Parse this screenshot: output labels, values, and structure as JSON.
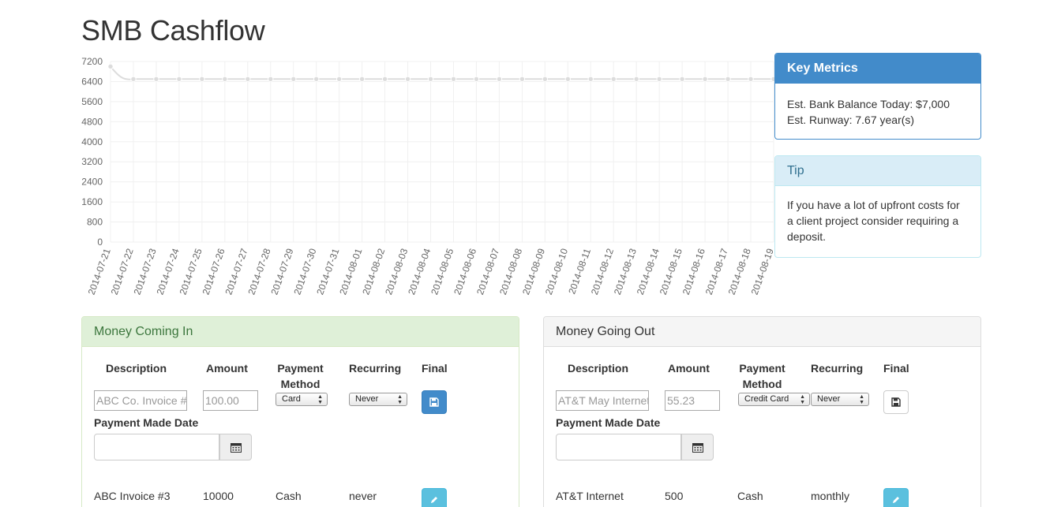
{
  "page": {
    "title": "SMB Cashflow"
  },
  "chart_data": {
    "type": "line",
    "categories": [
      "2014-07-21",
      "2014-07-22",
      "2014-07-23",
      "2014-07-24",
      "2014-07-25",
      "2014-07-26",
      "2014-07-27",
      "2014-07-28",
      "2014-07-29",
      "2014-07-30",
      "2014-07-31",
      "2014-08-01",
      "2014-08-02",
      "2014-08-03",
      "2014-08-04",
      "2014-08-05",
      "2014-08-06",
      "2014-08-07",
      "2014-08-08",
      "2014-08-09",
      "2014-08-10",
      "2014-08-11",
      "2014-08-12",
      "2014-08-13",
      "2014-08-14",
      "2014-08-15",
      "2014-08-16",
      "2014-08-17",
      "2014-08-18",
      "2014-08-19"
    ],
    "values": [
      7000,
      6500,
      6500,
      6500,
      6500,
      6500,
      6500,
      6500,
      6500,
      6500,
      6500,
      6500,
      6500,
      6500,
      6500,
      6500,
      6500,
      6500,
      6500,
      6500,
      6500,
      6500,
      6500,
      6500,
      6500,
      6500,
      6500,
      6500,
      6500,
      6500
    ],
    "yticks": [
      0,
      800,
      1600,
      2400,
      3200,
      4000,
      4800,
      5600,
      6400,
      7200
    ],
    "ylim": [
      0,
      7200
    ],
    "grid": true,
    "colors": {
      "line": "#dcdcdc",
      "point": "#dcdcdc",
      "grid": "#f0f0f0",
      "tick_text": "#666666"
    }
  },
  "metrics": {
    "heading": "Key Metrics",
    "balance": "Est. Bank Balance Today: $7,000",
    "runway": "Est. Runway: 7.67 year(s)"
  },
  "tip": {
    "heading": "Tip",
    "text": "If you have a lot of upfront costs for a client project consider requiring a deposit."
  },
  "money_in": {
    "heading": "Money Coming In",
    "columns": {
      "description": "Description",
      "amount": "Amount",
      "payment_method": "Payment Method",
      "recurring": "Recurring",
      "final": "Final"
    },
    "new_entry": {
      "description_placeholder": "ABC Co. Invoice #",
      "amount_placeholder": "100.00",
      "payment_method": "Card",
      "recurring": "Never"
    },
    "date_label": "Payment Made Date",
    "rows": [
      {
        "description": "ABC Invoice #3",
        "amount": "10000",
        "payment_method": "Cash",
        "recurring": "never"
      }
    ]
  },
  "money_out": {
    "heading": "Money Going Out",
    "columns": {
      "description": "Description",
      "amount": "Amount",
      "payment_method": "Payment Method",
      "recurring": "Recurring",
      "final": "Final"
    },
    "new_entry": {
      "description_placeholder": "AT&T May Internet",
      "amount_placeholder": "55.23",
      "payment_method": "Credit Card",
      "recurring": "Never"
    },
    "date_label": "Payment Made Date",
    "rows": [
      {
        "description": "AT&T Internet",
        "amount": "500",
        "payment_method": "Cash",
        "recurring": "monthly"
      }
    ]
  },
  "icons": {
    "save": "floppy-disk-icon",
    "calendar": "calendar-icon",
    "edit": "pencil-icon"
  }
}
